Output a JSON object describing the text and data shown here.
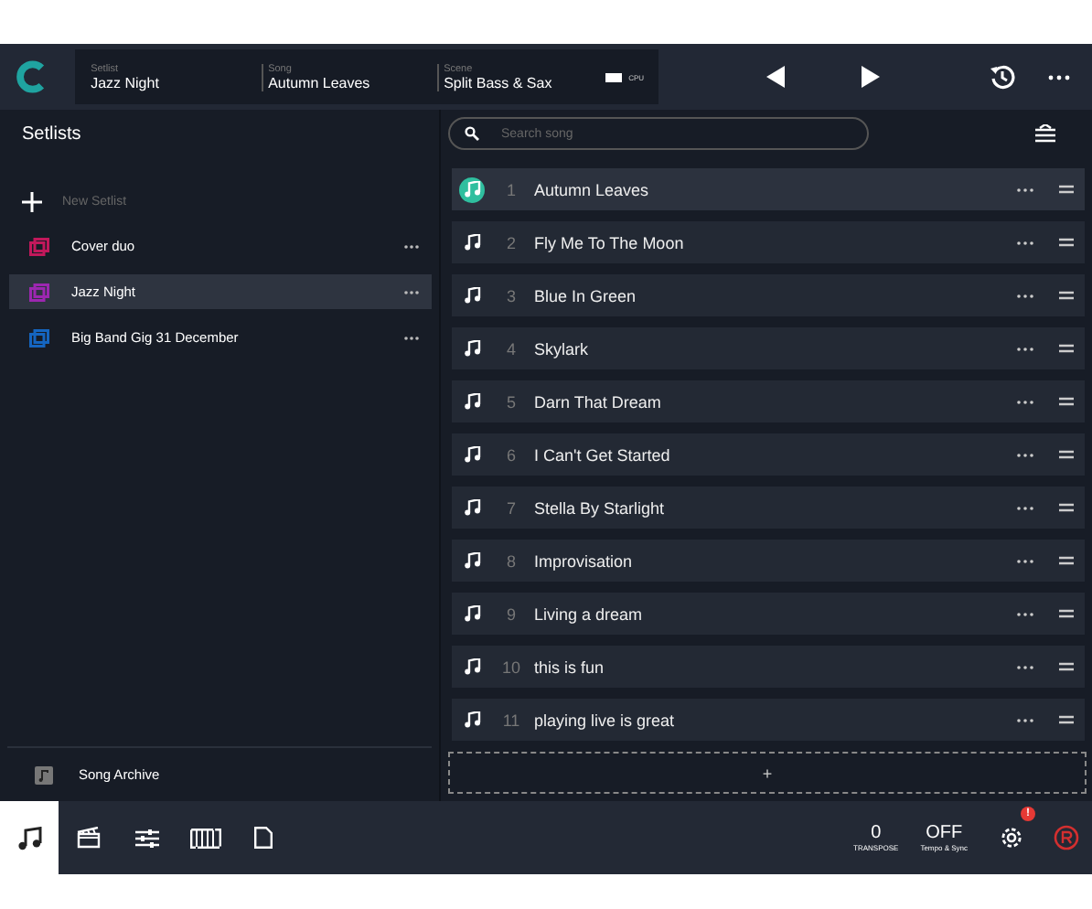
{
  "header": {
    "fields": [
      {
        "label": "Setlist",
        "value": "Jazz Night"
      },
      {
        "label": "Song",
        "value": "Autumn Leaves"
      },
      {
        "label": "Scene",
        "value": "Split Bass & Sax"
      }
    ],
    "cpu_label": "CPU"
  },
  "sidebar": {
    "title": "Setlists",
    "new_label": "New Setlist",
    "items": [
      {
        "name": "Cover duo",
        "color": "#c2185b",
        "selected": false
      },
      {
        "name": "Jazz Night",
        "color": "#9c27b0",
        "selected": true
      },
      {
        "name": "Big Band Gig 31 December",
        "color": "#1565c0",
        "selected": false
      }
    ],
    "archive_label": "Song Archive"
  },
  "search": {
    "placeholder": "Search song"
  },
  "songs": [
    {
      "number": "1",
      "title": "Autumn Leaves",
      "selected": true
    },
    {
      "number": "2",
      "title": "Fly Me To The Moon",
      "selected": false
    },
    {
      "number": "3",
      "title": "Blue In Green",
      "selected": false
    },
    {
      "number": "4",
      "title": "Skylark",
      "selected": false
    },
    {
      "number": "5",
      "title": "Darn That Dream",
      "selected": false
    },
    {
      "number": "6",
      "title": "I Can't Get Started",
      "selected": false
    },
    {
      "number": "7",
      "title": "Stella By Starlight",
      "selected": false
    },
    {
      "number": "8",
      "title": "Improvisation",
      "selected": false
    },
    {
      "number": "9",
      "title": "Living a dream",
      "selected": false
    },
    {
      "number": "10",
      "title": "this is fun",
      "selected": false
    },
    {
      "number": "11",
      "title": "playing live is great",
      "selected": false
    }
  ],
  "add_label": "+",
  "bottom_bar": {
    "tabs": [
      {
        "kind": "note",
        "selected": true
      },
      {
        "kind": "clapper",
        "selected": false
      },
      {
        "kind": "sliders",
        "selected": false
      },
      {
        "kind": "keyboard",
        "selected": false
      },
      {
        "kind": "page",
        "selected": false
      }
    ],
    "transpose": {
      "value": "0",
      "label": "TRANSPOSE"
    },
    "tempo": {
      "value": "OFF",
      "label": "Tempo & Sync"
    },
    "settings_badge": "!"
  }
}
